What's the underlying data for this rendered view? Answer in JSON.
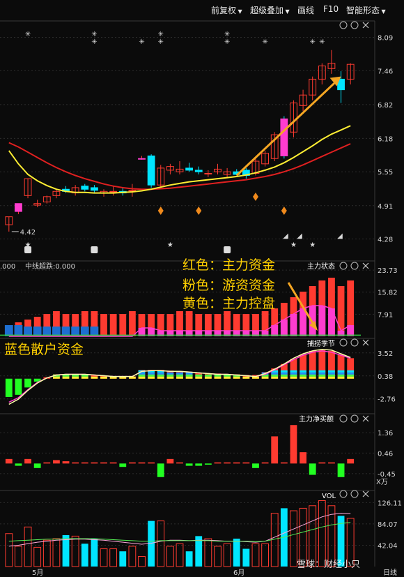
{
  "toolbar": {
    "items": [
      {
        "label": "前复权",
        "has_dropdown": true
      },
      {
        "label": "超级叠加",
        "has_dropdown": true
      },
      {
        "label": "画线",
        "has_dropdown": false
      },
      {
        "label": "F10",
        "has_dropdown": false
      },
      {
        "label": "智能形态",
        "has_dropdown": true
      }
    ]
  },
  "annotations": {
    "red": "红色：主力资金",
    "pink": "粉色：游资资金",
    "yellow": "黄色：主力控盘",
    "blue": "蓝色散户资金"
  },
  "watermark": "雪球：财经小只",
  "period_label": "日线",
  "colors": {
    "up": "#ff3b30",
    "down": "#00e5ff",
    "pink": "#ff3ccf",
    "ma_yellow": "#ffee33",
    "ma_red": "#e02020",
    "background": "#0b0b0b",
    "annotation": "#ffd000",
    "retail_blue": "#1e6fd0"
  },
  "chart_data": [
    {
      "name": "price",
      "type": "candlestick",
      "y_ticks": [
        "8.09",
        "7.46",
        "6.82",
        "6.18",
        "5.55",
        "4.91",
        "4.28"
      ],
      "ylim": [
        4.05,
        8.4
      ],
      "low_annotation": "4.42",
      "x_labels": [
        "5月",
        "6月"
      ],
      "candles": [
        {
          "o": 4.55,
          "h": 4.7,
          "l": 4.42,
          "c": 4.7
        },
        {
          "o": 4.8,
          "h": 4.95,
          "l": 4.75,
          "c": 4.95
        },
        {
          "o": 5.1,
          "h": 5.42,
          "l": 5.05,
          "c": 5.42
        },
        {
          "o": 4.92,
          "h": 5.02,
          "l": 4.88,
          "c": 4.95
        },
        {
          "o": 4.98,
          "h": 5.1,
          "l": 4.95,
          "c": 5.08
        },
        {
          "o": 5.1,
          "h": 5.22,
          "l": 5.05,
          "c": 5.18
        },
        {
          "o": 5.22,
          "h": 5.28,
          "l": 5.15,
          "c": 5.18
        },
        {
          "o": 5.15,
          "h": 5.3,
          "l": 5.1,
          "c": 5.25
        },
        {
          "o": 5.28,
          "h": 5.32,
          "l": 5.18,
          "c": 5.22
        },
        {
          "o": 5.25,
          "h": 5.3,
          "l": 5.15,
          "c": 5.2
        },
        {
          "o": 5.15,
          "h": 5.22,
          "l": 5.08,
          "c": 5.18
        },
        {
          "o": 5.18,
          "h": 5.28,
          "l": 5.1,
          "c": 5.18
        },
        {
          "o": 5.18,
          "h": 5.25,
          "l": 5.1,
          "c": 5.15
        },
        {
          "o": 5.2,
          "h": 5.32,
          "l": 5.08,
          "c": 5.2
        },
        {
          "o": 5.8,
          "h": 5.85,
          "l": 5.78,
          "c": 5.8
        },
        {
          "o": 5.85,
          "h": 5.88,
          "l": 5.25,
          "c": 5.3
        },
        {
          "o": 5.3,
          "h": 5.68,
          "l": 5.25,
          "c": 5.62
        },
        {
          "o": 5.58,
          "h": 5.7,
          "l": 5.5,
          "c": 5.65
        },
        {
          "o": 5.55,
          "h": 5.75,
          "l": 5.5,
          "c": 5.6
        },
        {
          "o": 5.62,
          "h": 5.72,
          "l": 5.55,
          "c": 5.58
        },
        {
          "o": 5.58,
          "h": 5.65,
          "l": 5.5,
          "c": 5.55
        },
        {
          "o": 5.52,
          "h": 5.58,
          "l": 5.45,
          "c": 5.52
        },
        {
          "o": 5.55,
          "h": 5.7,
          "l": 5.5,
          "c": 5.6
        },
        {
          "o": 5.5,
          "h": 5.62,
          "l": 5.45,
          "c": 5.55
        },
        {
          "o": 5.55,
          "h": 5.6,
          "l": 5.48,
          "c": 5.5
        },
        {
          "o": 5.58,
          "h": 5.62,
          "l": 5.42,
          "c": 5.48
        },
        {
          "o": 5.52,
          "h": 5.8,
          "l": 5.48,
          "c": 5.75
        },
        {
          "o": 5.7,
          "h": 5.95,
          "l": 5.65,
          "c": 5.9
        },
        {
          "o": 5.8,
          "h": 6.3,
          "l": 5.75,
          "c": 6.25
        },
        {
          "o": 6.55,
          "h": 6.6,
          "l": 5.8,
          "c": 5.85
        },
        {
          "o": 6.3,
          "h": 6.9,
          "l": 6.2,
          "c": 6.85
        },
        {
          "o": 6.8,
          "h": 7.1,
          "l": 6.7,
          "c": 7.0
        },
        {
          "o": 7.0,
          "h": 7.35,
          "l": 6.9,
          "c": 7.3
        },
        {
          "o": 7.3,
          "h": 7.6,
          "l": 7.2,
          "c": 7.55
        },
        {
          "o": 7.5,
          "h": 7.85,
          "l": 7.4,
          "c": 7.6
        },
        {
          "o": 7.3,
          "h": 7.45,
          "l": 6.85,
          "c": 7.1
        },
        {
          "o": 7.3,
          "h": 7.6,
          "l": 7.2,
          "c": 7.58
        }
      ],
      "ma_yellow": [
        5.95,
        5.7,
        5.5,
        5.38,
        5.29,
        5.22,
        5.18,
        5.16,
        5.16,
        5.15,
        5.15,
        5.15,
        5.16,
        5.17,
        5.19,
        5.22,
        5.26,
        5.3,
        5.33,
        5.36,
        5.38,
        5.4,
        5.42,
        5.44,
        5.46,
        5.49,
        5.53,
        5.58,
        5.64,
        5.72,
        5.82,
        5.93,
        6.04,
        6.16,
        6.26,
        6.34,
        6.42
      ],
      "ma_red": [
        6.1,
        6.02,
        5.92,
        5.82,
        5.72,
        5.63,
        5.55,
        5.48,
        5.42,
        5.37,
        5.32,
        5.28,
        5.25,
        5.23,
        5.22,
        5.22,
        5.23,
        5.24,
        5.26,
        5.28,
        5.3,
        5.32,
        5.34,
        5.36,
        5.38,
        5.4,
        5.43,
        5.46,
        5.5,
        5.55,
        5.61,
        5.68,
        5.76,
        5.84,
        5.92,
        6.0,
        6.08
      ],
      "trend_arrow": {
        "from": {
          "i": 24,
          "v": 5.48
        },
        "to": {
          "i": 35,
          "v": 7.35
        }
      }
    },
    {
      "name": "主力状态",
      "type": "bar",
      "left_readout_1": ".000",
      "left_readout_2": "中线超跌:0.000",
      "y_ticks": [
        "23.73",
        "15.82",
        "7.91"
      ],
      "ylim": [
        0,
        27
      ],
      "red": [
        4,
        5,
        6,
        7,
        8,
        9,
        8,
        8,
        9,
        9,
        8,
        8,
        8,
        9,
        8,
        8,
        8,
        8,
        9,
        9,
        8,
        8,
        8,
        9,
        8,
        8,
        8,
        9,
        10,
        12,
        14,
        16,
        18,
        20,
        21,
        18,
        20
      ],
      "pink": [
        0,
        0,
        0,
        0,
        0,
        0,
        0,
        0,
        0,
        0,
        0,
        0,
        0,
        0,
        3,
        3,
        2,
        2,
        2,
        2,
        2,
        2,
        2,
        2,
        2,
        2,
        2,
        2,
        4,
        6,
        8,
        10,
        11,
        11,
        10,
        2,
        4
      ],
      "blue": [
        4,
        4,
        3.5,
        3.5,
        3.5,
        3.5,
        3.5,
        3.5,
        3.5,
        3.5,
        0,
        0,
        0,
        0,
        0,
        0,
        0,
        0,
        0,
        0,
        0,
        0,
        0,
        0,
        0,
        0,
        0,
        0,
        0,
        0,
        0,
        0,
        0,
        0,
        0,
        0,
        0
      ],
      "yellow_line": [
        0.4,
        0.4,
        0.4,
        0.4,
        0.4,
        0.4,
        0.4,
        0.4,
        0.4,
        0.4,
        0.4,
        0.4,
        0.4,
        0.4,
        0.4,
        0.4,
        0.4,
        0.4,
        0.4,
        0.4,
        0.4,
        0.4,
        0.4,
        0.4,
        0.4,
        0.4,
        0.4,
        0.4,
        0.4,
        0.4,
        0.4,
        0.4,
        0.4,
        0.4,
        0.4,
        0.4,
        0.4
      ]
    },
    {
      "name": "捕捞季节",
      "type": "bar",
      "y_ticks": [
        "3.52",
        "0.38",
        "-2.76"
      ],
      "ylim": [
        -4.5,
        5.5
      ],
      "values": [
        -2.5,
        -2.2,
        -1.2,
        -0.4,
        0.2,
        0.6,
        0.6,
        0.6,
        0.6,
        0.5,
        0.4,
        0.3,
        0.3,
        0.3,
        1.2,
        1.2,
        1.2,
        1.1,
        1.0,
        0.9,
        0.8,
        0.7,
        0.7,
        0.6,
        0.6,
        0.5,
        0.5,
        0.9,
        1.4,
        2.0,
        2.7,
        3.3,
        3.8,
        3.9,
        3.8,
        3.3,
        2.8
      ],
      "line_yellow": [
        -3.5,
        -2.8,
        -1.6,
        -0.6,
        0.1,
        0.5,
        0.6,
        0.6,
        0.6,
        0.5,
        0.4,
        0.3,
        0.3,
        0.3,
        1.0,
        1.1,
        1.1,
        1.0,
        1.0,
        0.9,
        0.8,
        0.7,
        0.6,
        0.6,
        0.5,
        0.4,
        0.3,
        0.7,
        1.3,
        2.0,
        2.8,
        3.4,
        3.8,
        4.0,
        3.9,
        3.4,
        2.9
      ],
      "line_pink": [
        -3.2,
        -2.6,
        -1.5,
        -0.5,
        0.1,
        0.5,
        0.6,
        0.6,
        0.6,
        0.5,
        0.4,
        0.3,
        0.3,
        0.3,
        1.0,
        1.1,
        1.1,
        1.0,
        1.0,
        0.9,
        0.8,
        0.7,
        0.6,
        0.6,
        0.5,
        0.4,
        0.3,
        0.6,
        1.2,
        1.9,
        2.6,
        3.2,
        3.6,
        3.8,
        3.6,
        3.2,
        2.8
      ]
    },
    {
      "name": "主力净买额",
      "type": "bar",
      "y_ticks": [
        "1.36",
        "0.46",
        "-0.45"
      ],
      "unit": "X万",
      "ylim": [
        -1.1,
        2.2
      ],
      "values": [
        0.2,
        -0.1,
        0.2,
        -0.2,
        0.05,
        0.15,
        0.1,
        0.05,
        0.05,
        0.05,
        0.05,
        0.05,
        -0.15,
        0.05,
        0.05,
        0.05,
        -0.6,
        0.2,
        0.05,
        -0.1,
        -0.1,
        -0.05,
        0.05,
        0.05,
        0.05,
        0.05,
        -0.2,
        0.05,
        1.2,
        0.05,
        1.7,
        0.5,
        -0.5,
        0.05,
        0.05,
        -0.6,
        0.2
      ]
    },
    {
      "name": "VOL",
      "type": "bar",
      "y_ticks": [
        "126.11",
        "84.07",
        "42.04"
      ],
      "ylim": [
        0,
        150
      ],
      "values": [
        65,
        40,
        78,
        38,
        52,
        55,
        62,
        60,
        45,
        55,
        35,
        35,
        30,
        40,
        20,
        90,
        90,
        40,
        45,
        30,
        60,
        55,
        40,
        45,
        55,
        35,
        45,
        45,
        105,
        115,
        110,
        115,
        120,
        130,
        120,
        100,
        95
      ],
      "ma1": [
        40,
        42,
        45,
        48,
        50,
        52,
        53,
        54,
        54,
        53,
        52,
        50,
        48,
        46,
        44,
        46,
        50,
        52,
        52,
        51,
        52,
        52,
        51,
        50,
        50,
        49,
        48,
        50,
        58,
        66,
        74,
        82,
        90,
        98,
        103,
        105,
        104
      ],
      "ma2": [
        50,
        51,
        52,
        53,
        54,
        54,
        55,
        55,
        55,
        55,
        54,
        53,
        52,
        51,
        50,
        50,
        51,
        51,
        51,
        51,
        51,
        51,
        50,
        50,
        50,
        50,
        49,
        50,
        54,
        58,
        63,
        68,
        73,
        78,
        82,
        85,
        87
      ]
    }
  ]
}
